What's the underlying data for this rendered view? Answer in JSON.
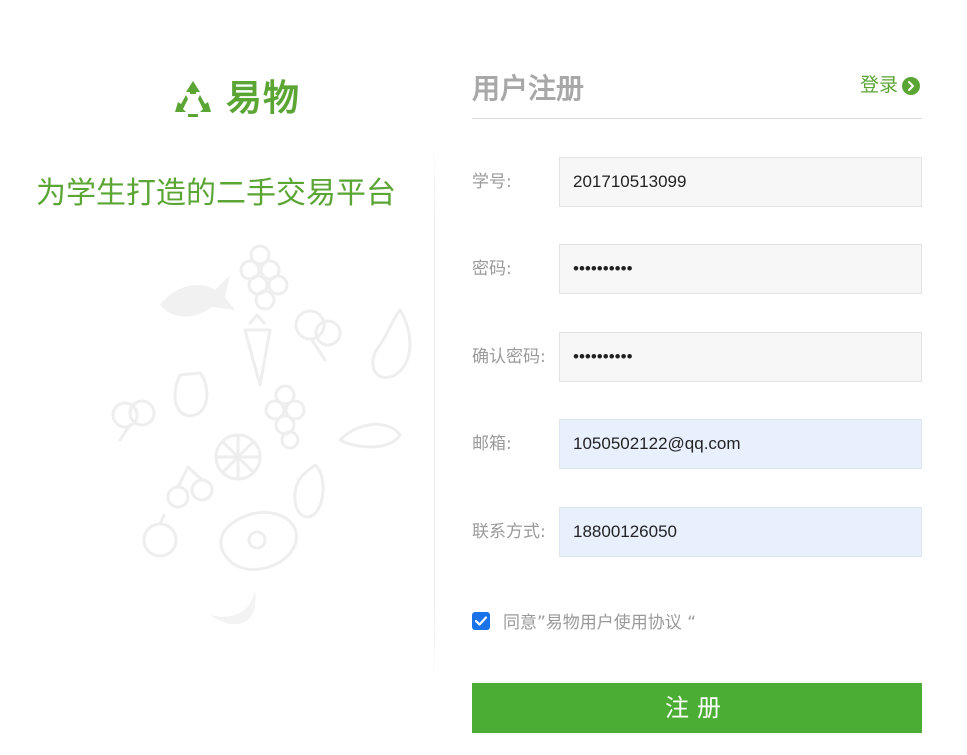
{
  "brand": {
    "logo_icon": "recycle-icon",
    "name": "易物",
    "slogan": "为学生打造的二手交易平台",
    "accent_color": "#5aa534"
  },
  "form": {
    "title": "用户注册",
    "login_link": "登录",
    "login_icon": "arrow-circle-right-icon",
    "fields": [
      {
        "label": "学号:",
        "value": "201710513099",
        "type": "text"
      },
      {
        "label": "密码:",
        "value": "••••••••••",
        "type": "password"
      },
      {
        "label": "确认密码:",
        "value": "••••••••••",
        "type": "password"
      },
      {
        "label": "邮箱:",
        "value": "1050502122@qq.com",
        "type": "text"
      },
      {
        "label": "联系方式:",
        "value": "18800126050",
        "type": "text"
      }
    ],
    "agreement": {
      "checked": true,
      "text": "同意”易物用户使用协议 “"
    },
    "submit_label": "注册",
    "submit_color": "#4bad34"
  }
}
